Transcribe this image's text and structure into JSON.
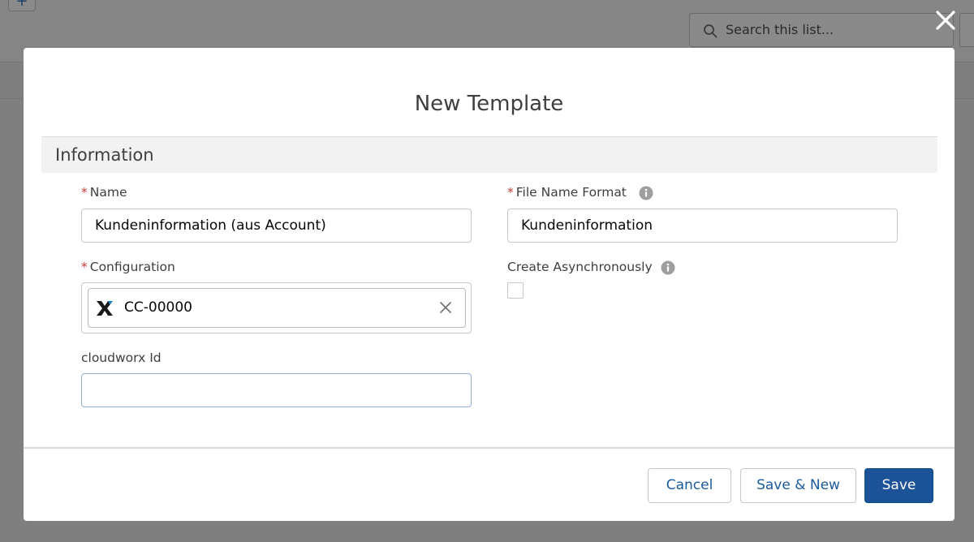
{
  "background": {
    "search_placeholder": "Search this list..."
  },
  "modal": {
    "title": "New Template",
    "section_title": "Information",
    "fields": {
      "name": {
        "label": "Name",
        "value": "Kundeninformation (aus Account)",
        "required_mark": "*"
      },
      "file_name_format": {
        "label": "File Name Format",
        "value": "Kundeninformation",
        "required_mark": "*"
      },
      "configuration": {
        "label": "Configuration",
        "value": "CC-00000",
        "required_mark": "*"
      },
      "create_asynchronously": {
        "label": "Create Asynchronously",
        "checked": false
      },
      "cloudworx_id": {
        "label": "cloudworx Id",
        "value": ""
      }
    },
    "buttons": {
      "cancel": "Cancel",
      "save_new": "Save & New",
      "save": "Save"
    }
  },
  "colors": {
    "brand": "#1b5298",
    "required": "#c23934",
    "overlay": "#7f7f7f"
  },
  "icons": [
    "search-icon",
    "close-icon",
    "info-icon",
    "cloudworx-logo-icon",
    "remove-icon"
  ]
}
